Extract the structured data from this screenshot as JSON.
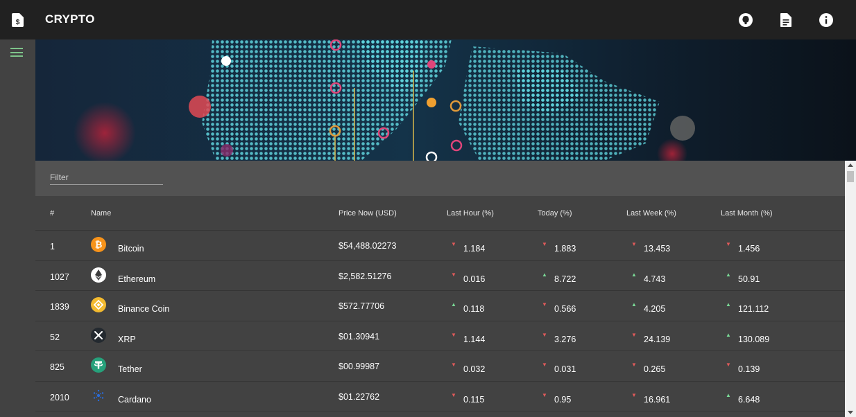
{
  "app": {
    "title": "CRYPTO",
    "icons": [
      "receipt-dollar-icon",
      "github-icon",
      "document-icon",
      "info-icon",
      "menu-icon"
    ]
  },
  "filter": {
    "placeholder": "Filter",
    "value": ""
  },
  "table": {
    "headers": {
      "rank": "#",
      "name": "Name",
      "price": "Price Now (USD)",
      "hour": "Last Hour (%)",
      "today": "Today (%)",
      "week": "Last Week (%)",
      "month": "Last Month (%)"
    },
    "rows": [
      {
        "rank": "1",
        "name": "Bitcoin",
        "icon": "bitcoin-icon",
        "price": "$54,488.02273",
        "hour": {
          "value": "1.184",
          "trend": "down"
        },
        "today": {
          "value": "1.883",
          "trend": "down"
        },
        "week": {
          "value": "13.453",
          "trend": "down"
        },
        "month": {
          "value": "1.456",
          "trend": "down"
        }
      },
      {
        "rank": "1027",
        "name": "Ethereum",
        "icon": "ethereum-icon",
        "price": "$2,582.51276",
        "hour": {
          "value": "0.016",
          "trend": "down"
        },
        "today": {
          "value": "8.722",
          "trend": "up"
        },
        "week": {
          "value": "4.743",
          "trend": "up"
        },
        "month": {
          "value": "50.91",
          "trend": "up"
        }
      },
      {
        "rank": "1839",
        "name": "Binance Coin",
        "icon": "binance-coin-icon",
        "price": "$572.77706",
        "hour": {
          "value": "0.118",
          "trend": "up"
        },
        "today": {
          "value": "0.566",
          "trend": "down"
        },
        "week": {
          "value": "4.205",
          "trend": "up"
        },
        "month": {
          "value": "121.112",
          "trend": "up"
        }
      },
      {
        "rank": "52",
        "name": "XRP",
        "icon": "xrp-icon",
        "price": "$01.30941",
        "hour": {
          "value": "1.144",
          "trend": "down"
        },
        "today": {
          "value": "3.276",
          "trend": "down"
        },
        "week": {
          "value": "24.139",
          "trend": "down"
        },
        "month": {
          "value": "130.089",
          "trend": "up"
        }
      },
      {
        "rank": "825",
        "name": "Tether",
        "icon": "tether-icon",
        "price": "$00.99987",
        "hour": {
          "value": "0.032",
          "trend": "down"
        },
        "today": {
          "value": "0.031",
          "trend": "down"
        },
        "week": {
          "value": "0.265",
          "trend": "down"
        },
        "month": {
          "value": "0.139",
          "trend": "down"
        }
      },
      {
        "rank": "2010",
        "name": "Cardano",
        "icon": "cardano-icon",
        "price": "$01.22762",
        "hour": {
          "value": "0.115",
          "trend": "down"
        },
        "today": {
          "value": "0.95",
          "trend": "down"
        },
        "week": {
          "value": "16.961",
          "trend": "down"
        },
        "month": {
          "value": "6.648",
          "trend": "up"
        }
      }
    ]
  },
  "colors": {
    "topbar": "#212121",
    "sidenav": "#424242",
    "surface": "#424242",
    "filterBar": "#525252",
    "up": "#7ad996",
    "down": "#e05a5a",
    "menuIcon": "#7ec48a"
  }
}
